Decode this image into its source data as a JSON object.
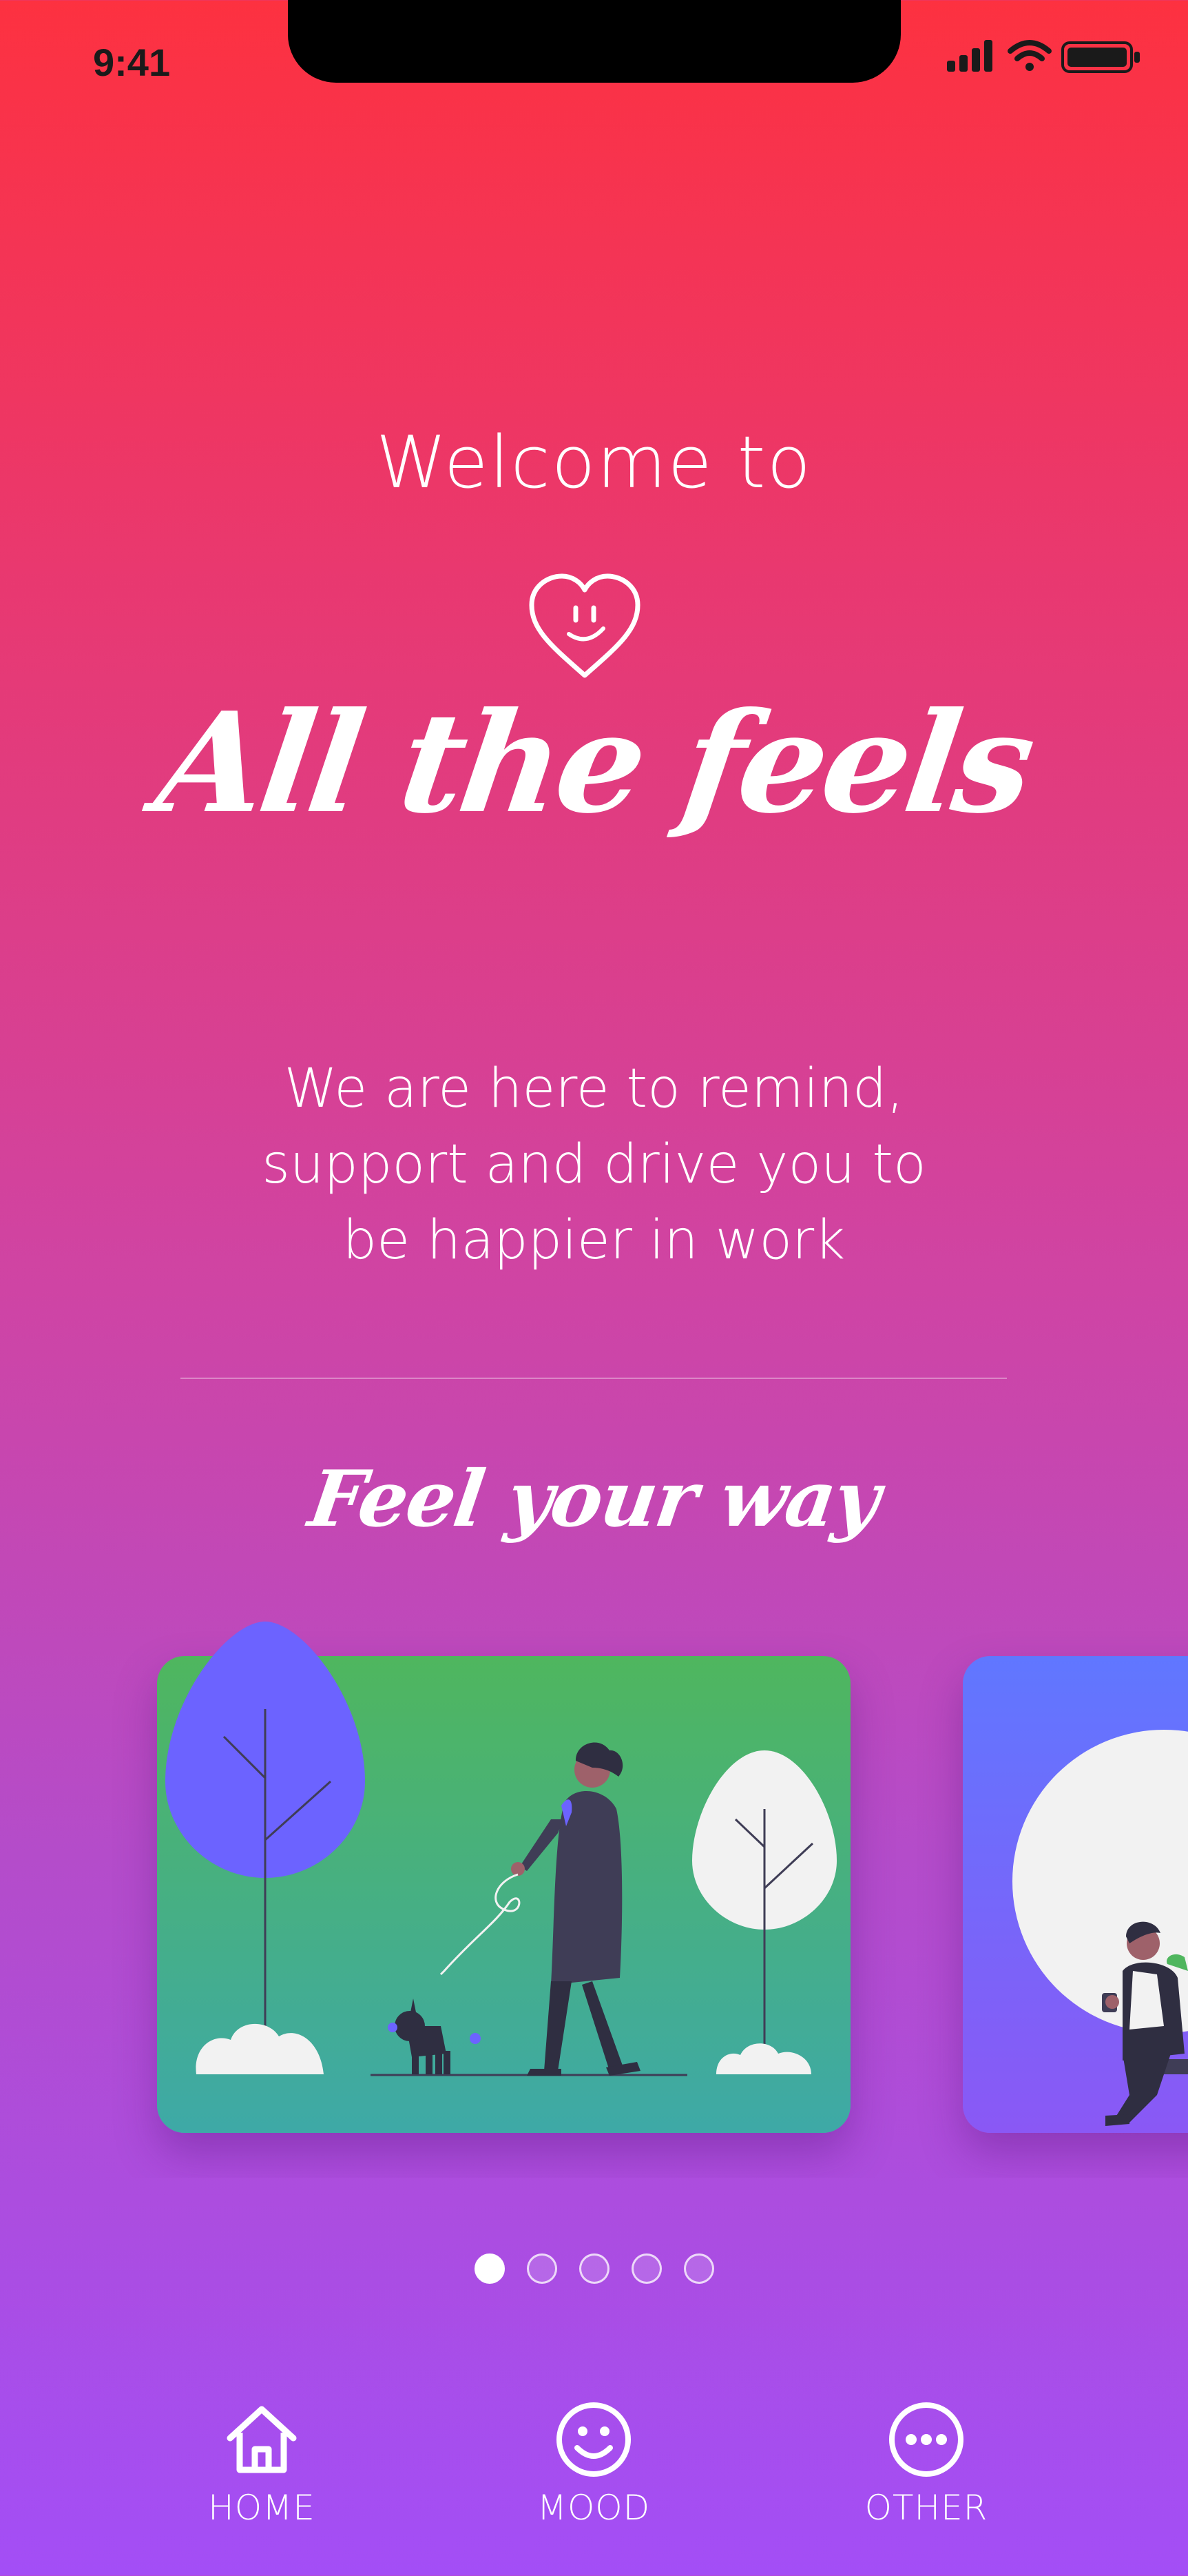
{
  "status_bar": {
    "time": "9:41",
    "icons": [
      "signal-icon",
      "wifi-icon",
      "battery-icon"
    ]
  },
  "hero": {
    "welcome": "Welcome to",
    "logo_icon": "heart-smile-icon",
    "app_name": "All the feels",
    "tagline_lines": [
      "We are here to remind,",
      "support and drive you to",
      "be happier in work"
    ]
  },
  "section": {
    "title": "Feel your way"
  },
  "carousel": {
    "cards": [
      {
        "illustration": "woman-walking-dog",
        "background": "#4fb65e"
      },
      {
        "illustration": "man-sitting-with-coffee",
        "background": "#6077ff"
      }
    ],
    "page_count": 5,
    "active_page": 1
  },
  "tab_bar": {
    "items": [
      {
        "label": "HOME",
        "icon": "home-icon"
      },
      {
        "label": "MOOD",
        "icon": "smiley-icon"
      },
      {
        "label": "OTHER",
        "icon": "more-dots-icon"
      }
    ]
  },
  "colors": {
    "gradient_top": "#fd3140",
    "gradient_bottom": "#a34ef6",
    "text": "#ffffff"
  }
}
